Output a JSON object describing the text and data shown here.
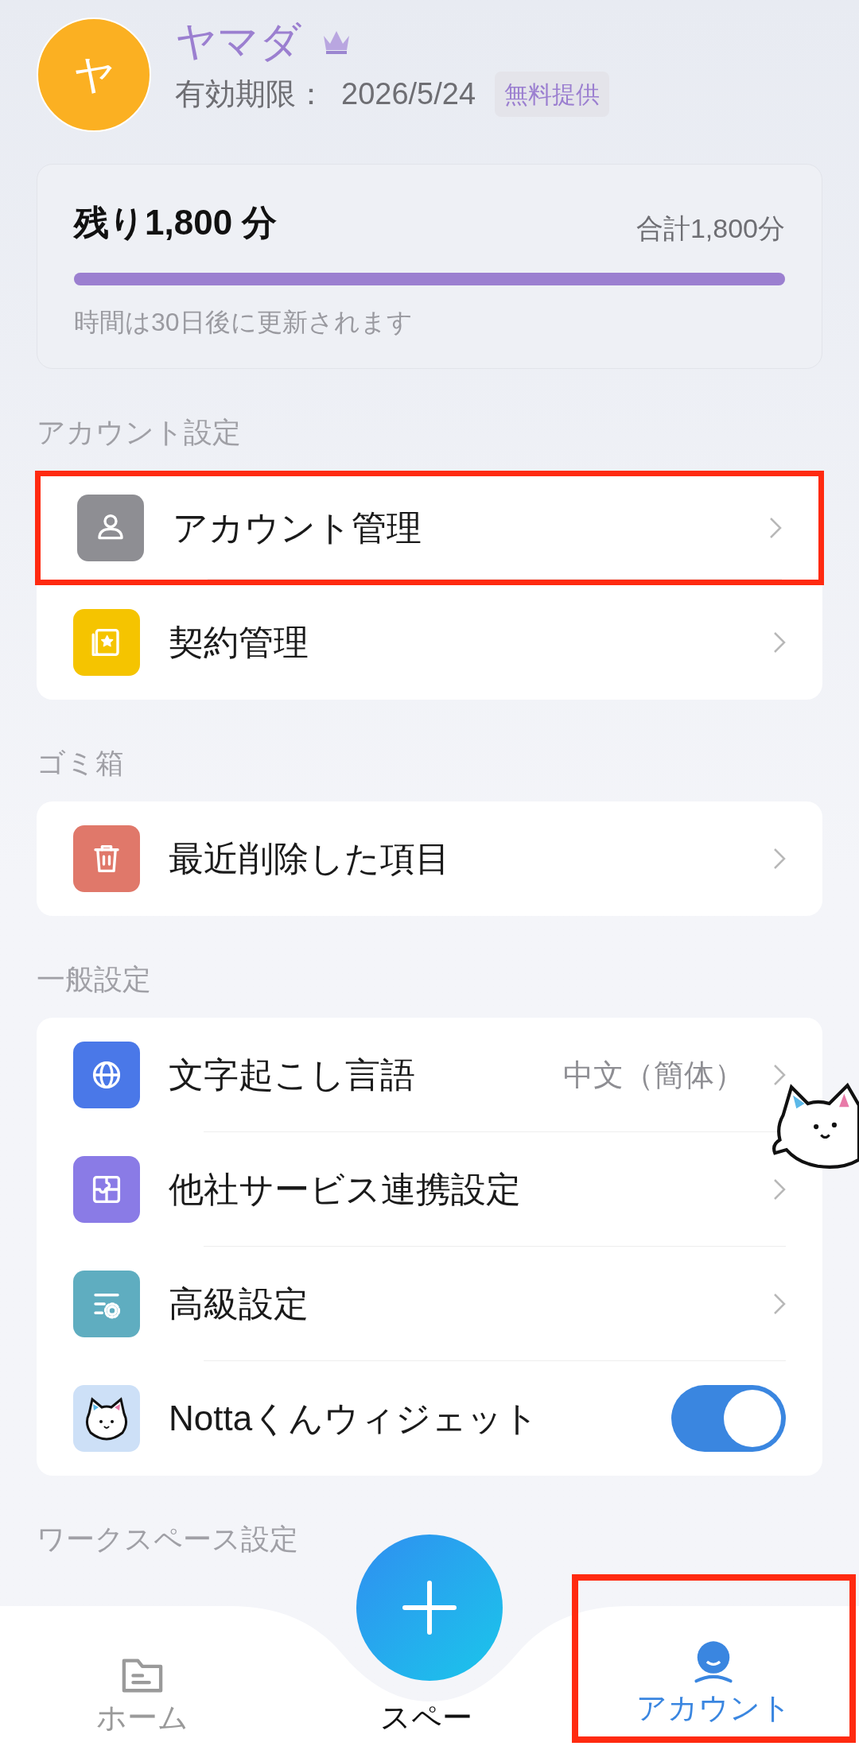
{
  "profile": {
    "avatar_letter": "ヤ",
    "name": "ヤマダ",
    "expiry_label": "有効期限：",
    "expiry_date": "2026/5/24",
    "badge": "無料提供"
  },
  "quota": {
    "remaining": "残り1,800 分",
    "total": "合計1,800分",
    "level": 1,
    "note": "時間は30日後に更新されます"
  },
  "sections": [
    {
      "title": "アカウント設定",
      "rows": [
        {
          "label": "アカウント管理",
          "kind": "chevron",
          "color": "#8e8e93",
          "highlighted": true
        },
        {
          "label": "契約管理",
          "kind": "chevron",
          "color": "#f5c400",
          "highlighted": false
        }
      ]
    },
    {
      "title": "ゴミ箱",
      "rows": [
        {
          "label": "最近削除した項目",
          "kind": "chevron",
          "color": "#e0786a",
          "highlighted": false
        }
      ]
    },
    {
      "title": "一般設定",
      "rows": [
        {
          "label": "文字起こし言語",
          "kind": "chevron",
          "value": "中文（簡体）",
          "color": "#4a78e8",
          "highlighted": false
        },
        {
          "label": "他社サービス連携設定",
          "kind": "chevron",
          "color": "#8a7be6",
          "highlighted": false
        },
        {
          "label": "高級設定",
          "kind": "chevron",
          "color": "#5fadc0",
          "highlighted": false
        },
        {
          "label": "Nottaくんウィジェット",
          "kind": "toggle",
          "on": true,
          "color": "#cde0f7",
          "highlighted": false
        }
      ]
    },
    {
      "title": "ワークスペース設定"
    }
  ],
  "tabs": [
    {
      "label": "ホーム",
      "selected": false,
      "highlighted": false
    },
    {
      "label": "スペー",
      "selected": false,
      "highlighted": false
    },
    {
      "label": "アカウント",
      "selected": true,
      "highlighted": true
    }
  ]
}
